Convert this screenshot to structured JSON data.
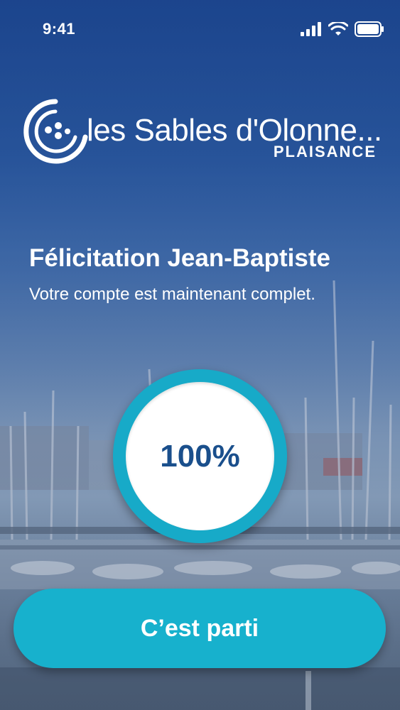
{
  "status_bar": {
    "time": "9:41"
  },
  "logo": {
    "main": "les Sables d'Olonne...",
    "sub": "PLAISANCE"
  },
  "headline": {
    "title": "Félicitation Jean-Baptiste",
    "subtitle": "Votre compte est maintenant complet."
  },
  "progress": {
    "label": "100%",
    "value": 1.0
  },
  "cta": {
    "label": "C’est parti"
  },
  "colors": {
    "accent": "#17b1cd",
    "progress_text": "#1a4f8c"
  }
}
